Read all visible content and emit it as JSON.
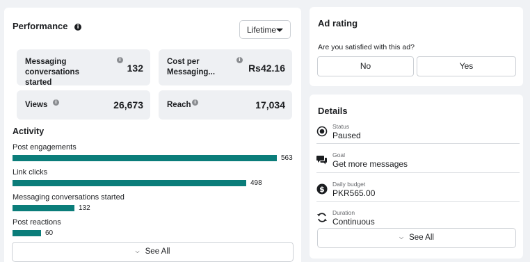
{
  "performance": {
    "title": "Performance",
    "range_select": "Lifetime",
    "metrics": [
      {
        "label": "Messaging conversations started",
        "value": "132"
      },
      {
        "label": "Cost per Messaging...",
        "value": "Rs42.16"
      },
      {
        "label": "Views",
        "value": "26,673"
      },
      {
        "label": "Reach",
        "value": "17,034"
      }
    ],
    "activity_title": "Activity",
    "activity": [
      {
        "label": "Post engagements",
        "value": "563",
        "fraction": 1.0
      },
      {
        "label": "Link clicks",
        "value": "498",
        "fraction": 0.885
      },
      {
        "label": "Messaging conversations started",
        "value": "132",
        "fraction": 0.234
      },
      {
        "label": "Post reactions",
        "value": "60",
        "fraction": 0.107
      }
    ],
    "see_all": "See All"
  },
  "ad_rating": {
    "title": "Ad rating",
    "question": "Are you satisfied with this ad?",
    "no_label": "No",
    "yes_label": "Yes"
  },
  "details": {
    "title": "Details",
    "rows": [
      {
        "small": "Status",
        "main": "Paused",
        "icon": "status-radio-icon"
      },
      {
        "small": "Goal",
        "main": "Get more messages",
        "icon": "chat-bubbles-icon"
      },
      {
        "small": "Daily budget",
        "main": "PKR565.00",
        "icon": "dollar-coin-icon"
      },
      {
        "small": "Duration",
        "main": "Continuous",
        "icon": "refresh-cycle-icon"
      }
    ],
    "see_all": "See All"
  },
  "colors": {
    "bar": "#0b7d7a",
    "card_bg": "#ffffff",
    "page_bg": "#f0f2f5",
    "metric_bg": "#eef0f3"
  }
}
